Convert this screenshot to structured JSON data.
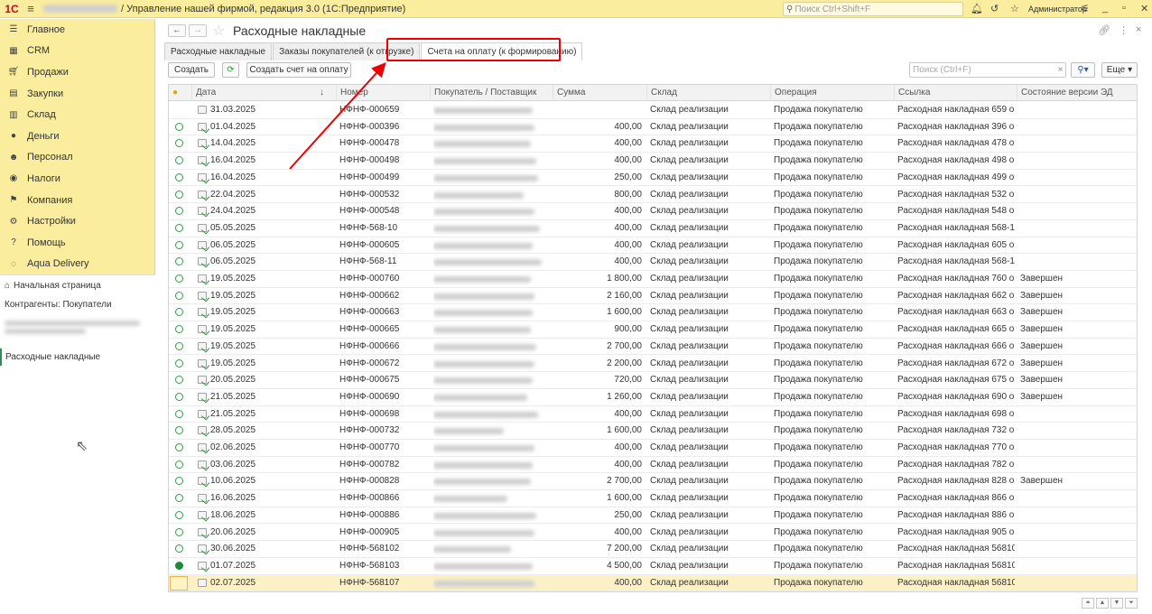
{
  "titlebar": {
    "logo": "1С",
    "title": "/ Управление нашей фирмой, редакция 3.0  (1С:Предприятие)",
    "search_placeholder": "Поиск Ctrl+Shift+F",
    "user": "Администратор"
  },
  "sidebar": {
    "items": [
      {
        "label": "Главное",
        "icon": "menu-icon"
      },
      {
        "label": "CRM",
        "icon": "crm-icon"
      },
      {
        "label": "Продажи",
        "icon": "cart-icon"
      },
      {
        "label": "Закупки",
        "icon": "purchase-icon"
      },
      {
        "label": "Склад",
        "icon": "warehouse-icon"
      },
      {
        "label": "Деньги",
        "icon": "money-icon"
      },
      {
        "label": "Персонал",
        "icon": "people-icon"
      },
      {
        "label": "Налоги",
        "icon": "tax-icon"
      },
      {
        "label": "Компания",
        "icon": "flag-icon"
      },
      {
        "label": "Настройки",
        "icon": "gear-icon"
      },
      {
        "label": "Помощь",
        "icon": "help-icon"
      },
      {
        "label": "Aqua Delivery",
        "icon": "aqua-icon"
      }
    ],
    "history": {
      "home": "Начальная страница",
      "contractors": "Контрагенты: Покупатели",
      "current": "Расходные накладные"
    }
  },
  "page": {
    "title": "Расходные накладные",
    "tabs": [
      {
        "label": "Расходные накладные"
      },
      {
        "label": "Заказы покупателей (к отгрузке)"
      },
      {
        "label": "Счета на оплату (к формированию)"
      }
    ],
    "toolbar": {
      "create": "Создать",
      "create_invoice": "Создать счет на оплату",
      "search_placeholder": "Поиск (Ctrl+F)",
      "more": "Еще"
    }
  },
  "table": {
    "columns": [
      "Дата",
      "Номер",
      "Покупатель / Поставщик",
      "Сумма",
      "Склад",
      "Операция",
      "Ссылка",
      "Состояние версии ЭД"
    ],
    "rows": [
      {
        "date": "31.03.2025",
        "number": "НФНФ-000659",
        "sum": "",
        "warehouse": "Склад реализации",
        "operation": "Продажа покупателю",
        "link": "Расходная накладная 659 о...",
        "state": "",
        "status": "none",
        "doc": "plain"
      },
      {
        "date": "01.04.2025",
        "number": "НФНФ-000396",
        "sum": "400,00",
        "warehouse": "Склад реализации",
        "operation": "Продажа покупателю",
        "link": "Расходная накладная 396 о...",
        "state": "",
        "status": "ring",
        "doc": "ok"
      },
      {
        "date": "14.04.2025",
        "number": "НФНФ-000478",
        "sum": "400,00",
        "warehouse": "Склад реализации",
        "operation": "Продажа покупателю",
        "link": "Расходная накладная 478 о...",
        "state": "",
        "status": "ring",
        "doc": "ok"
      },
      {
        "date": "16.04.2025",
        "number": "НФНФ-000498",
        "sum": "400,00",
        "warehouse": "Склад реализации",
        "operation": "Продажа покупателю",
        "link": "Расходная накладная 498 о...",
        "state": "",
        "status": "ring",
        "doc": "ok"
      },
      {
        "date": "16.04.2025",
        "number": "НФНФ-000499",
        "sum": "250,00",
        "warehouse": "Склад реализации",
        "operation": "Продажа покупателю",
        "link": "Расходная накладная 499 о...",
        "state": "",
        "status": "ring",
        "doc": "ok"
      },
      {
        "date": "22.04.2025",
        "number": "НФНФ-000532",
        "sum": "800,00",
        "warehouse": "Склад реализации",
        "operation": "Продажа покупателю",
        "link": "Расходная накладная 532 о...",
        "state": "",
        "status": "ring",
        "doc": "ok"
      },
      {
        "date": "24.04.2025",
        "number": "НФНФ-000548",
        "sum": "400,00",
        "warehouse": "Склад реализации",
        "operation": "Продажа покупателю",
        "link": "Расходная накладная 548 о...",
        "state": "",
        "status": "ring",
        "doc": "ok"
      },
      {
        "date": "05.05.2025",
        "number": "НФНФ-568-10",
        "sum": "400,00",
        "warehouse": "Склад реализации",
        "operation": "Продажа покупателю",
        "link": "Расходная накладная 568-1...",
        "state": "",
        "status": "ring",
        "doc": "ok"
      },
      {
        "date": "06.05.2025",
        "number": "НФНФ-000605",
        "sum": "400,00",
        "warehouse": "Склад реализации",
        "operation": "Продажа покупателю",
        "link": "Расходная накладная 605 о...",
        "state": "",
        "status": "ring",
        "doc": "ok"
      },
      {
        "date": "06.05.2025",
        "number": "НФНФ-568-11",
        "sum": "400,00",
        "warehouse": "Склад реализации",
        "operation": "Продажа покупателю",
        "link": "Расходная накладная 568-1...",
        "state": "",
        "status": "ring",
        "doc": "ok"
      },
      {
        "date": "19.05.2025",
        "number": "НФНФ-000760",
        "sum": "1 800,00",
        "warehouse": "Склад реализации",
        "operation": "Продажа покупателю",
        "link": "Расходная накладная 760 о...",
        "state": "Завершен",
        "status": "ring",
        "doc": "ok"
      },
      {
        "date": "19.05.2025",
        "number": "НФНФ-000662",
        "sum": "2 160,00",
        "warehouse": "Склад реализации",
        "operation": "Продажа покупателю",
        "link": "Расходная накладная 662 о...",
        "state": "Завершен",
        "status": "ring",
        "doc": "ok"
      },
      {
        "date": "19.05.2025",
        "number": "НФНФ-000663",
        "sum": "1 600,00",
        "warehouse": "Склад реализации",
        "operation": "Продажа покупателю",
        "link": "Расходная накладная 663 о...",
        "state": "Завершен",
        "status": "ring",
        "doc": "ok"
      },
      {
        "date": "19.05.2025",
        "number": "НФНФ-000665",
        "sum": "900,00",
        "warehouse": "Склад реализации",
        "operation": "Продажа покупателю",
        "link": "Расходная накладная 665 о...",
        "state": "Завершен",
        "status": "ring",
        "doc": "ok"
      },
      {
        "date": "19.05.2025",
        "number": "НФНФ-000666",
        "sum": "2 700,00",
        "warehouse": "Склад реализации",
        "operation": "Продажа покупателю",
        "link": "Расходная накладная 666 о...",
        "state": "Завершен",
        "status": "ring",
        "doc": "ok"
      },
      {
        "date": "19.05.2025",
        "number": "НФНФ-000672",
        "sum": "2 200,00",
        "warehouse": "Склад реализации",
        "operation": "Продажа покупателю",
        "link": "Расходная накладная 672 о...",
        "state": "Завершен",
        "status": "ring",
        "doc": "ok"
      },
      {
        "date": "20.05.2025",
        "number": "НФНФ-000675",
        "sum": "720,00",
        "warehouse": "Склад реализации",
        "operation": "Продажа покупателю",
        "link": "Расходная накладная 675 о...",
        "state": "Завершен",
        "status": "ring",
        "doc": "ok"
      },
      {
        "date": "21.05.2025",
        "number": "НФНФ-000690",
        "sum": "1 260,00",
        "warehouse": "Склад реализации",
        "operation": "Продажа покупателю",
        "link": "Расходная накладная 690 о...",
        "state": "Завершен",
        "status": "ring",
        "doc": "ok"
      },
      {
        "date": "21.05.2025",
        "number": "НФНФ-000698",
        "sum": "400,00",
        "warehouse": "Склад реализации",
        "operation": "Продажа покупателю",
        "link": "Расходная накладная 698 о...",
        "state": "",
        "status": "ring",
        "doc": "ok"
      },
      {
        "date": "28.05.2025",
        "number": "НФНФ-000732",
        "sum": "1 600,00",
        "warehouse": "Склад реализации",
        "operation": "Продажа покупателю",
        "link": "Расходная накладная 732 о...",
        "state": "",
        "status": "ring",
        "doc": "ok"
      },
      {
        "date": "02.06.2025",
        "number": "НФНФ-000770",
        "sum": "400,00",
        "warehouse": "Склад реализации",
        "operation": "Продажа покупателю",
        "link": "Расходная накладная 770 о...",
        "state": "",
        "status": "ring",
        "doc": "ok"
      },
      {
        "date": "03.06.2025",
        "number": "НФНФ-000782",
        "sum": "400,00",
        "warehouse": "Склад реализации",
        "operation": "Продажа покупателю",
        "link": "Расходная накладная 782 о...",
        "state": "",
        "status": "ring",
        "doc": "ok"
      },
      {
        "date": "10.06.2025",
        "number": "НФНФ-000828",
        "sum": "2 700,00",
        "warehouse": "Склад реализации",
        "operation": "Продажа покупателю",
        "link": "Расходная накладная 828 о...",
        "state": "Завершен",
        "status": "ring",
        "doc": "ok"
      },
      {
        "date": "16.06.2025",
        "number": "НФНФ-000866",
        "sum": "1 600,00",
        "warehouse": "Склад реализации",
        "operation": "Продажа покупателю",
        "link": "Расходная накладная 866 о...",
        "state": "",
        "status": "ring",
        "doc": "ok"
      },
      {
        "date": "18.06.2025",
        "number": "НФНФ-000886",
        "sum": "250,00",
        "warehouse": "Склад реализации",
        "operation": "Продажа покупателю",
        "link": "Расходная накладная 886 о...",
        "state": "",
        "status": "ring",
        "doc": "ok"
      },
      {
        "date": "20.06.2025",
        "number": "НФНФ-000905",
        "sum": "400,00",
        "warehouse": "Склад реализации",
        "operation": "Продажа покупателю",
        "link": "Расходная накладная 905 о...",
        "state": "",
        "status": "ring",
        "doc": "ok"
      },
      {
        "date": "30.06.2025",
        "number": "НФНФ-568102",
        "sum": "7 200,00",
        "warehouse": "Склад реализации",
        "operation": "Продажа покупателю",
        "link": "Расходная накладная 56810...",
        "state": "",
        "status": "ring",
        "doc": "ok"
      },
      {
        "date": "01.07.2025",
        "number": "НФНФ-568103",
        "sum": "4 500,00",
        "warehouse": "Склад реализации",
        "operation": "Продажа покупателю",
        "link": "Расходная накладная 56810...",
        "state": "",
        "status": "full",
        "doc": "ok"
      },
      {
        "date": "02.07.2025",
        "number": "НФНФ-568107",
        "sum": "400,00",
        "warehouse": "Склад реализации",
        "operation": "Продажа покупателю",
        "link": "Расходная накладная 56810...",
        "state": "",
        "status": "box",
        "doc": "plain"
      }
    ]
  },
  "colors": {
    "panel": "#fbed9e",
    "highlight": "#e00000",
    "status_green": "#1c8a3a",
    "selected_row": "#fbf0c6"
  }
}
